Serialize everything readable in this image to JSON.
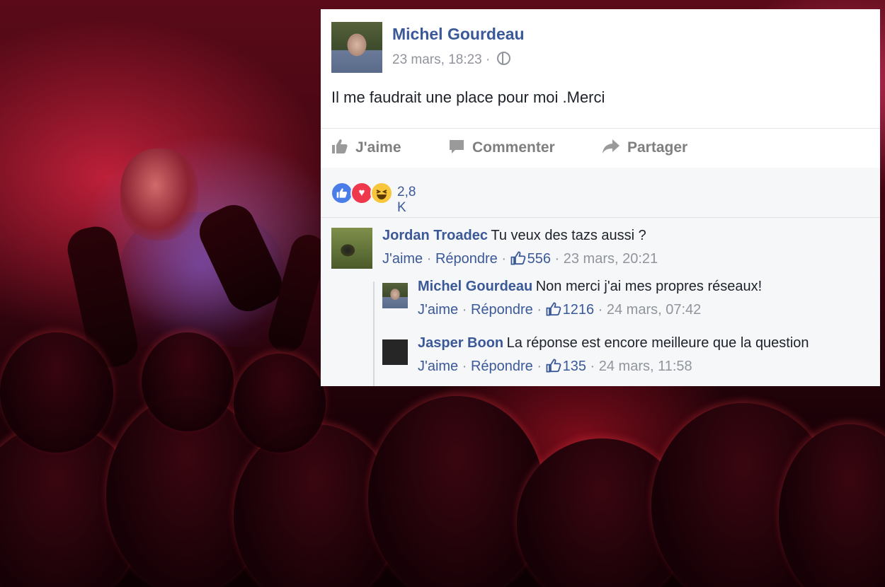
{
  "post": {
    "author": "Michel Gourdeau",
    "timestamp": "23 mars, 18:23 ·",
    "privacy_icon": "globe-icon",
    "text": "Il me faudrait une place pour moi .Merci"
  },
  "actions": {
    "like": "J'aime",
    "comment": "Commenter",
    "share": "Partager"
  },
  "reactions": {
    "icons": [
      "like-reaction-icon",
      "love-reaction-icon",
      "haha-reaction-icon"
    ],
    "count": "2,8 K"
  },
  "comments": [
    {
      "author": "Jordan Troadec",
      "text": "Tu veux des tazs aussi ?",
      "like_label": "J'aime",
      "reply_label": "Répondre",
      "likes": "556",
      "timestamp": "23 mars, 20:21"
    },
    {
      "author": "Michel Gourdeau",
      "text": "Non merci j'ai mes propres réseaux!",
      "like_label": "J'aime",
      "reply_label": "Répondre",
      "likes": "1216",
      "timestamp": "24 mars, 07:42"
    },
    {
      "author": "Jasper Boon",
      "text": "La réponse est encore meilleure que la question",
      "like_label": "J'aime",
      "reply_label": "Répondre",
      "likes": "135",
      "timestamp": "24 mars, 11:58"
    }
  ],
  "colors": {
    "link_blue": "#3b5998",
    "muted_gray": "#90949c",
    "like_blue": "#4a7de8",
    "love_red": "#f0384d",
    "haha_yellow": "#f7c63a"
  }
}
